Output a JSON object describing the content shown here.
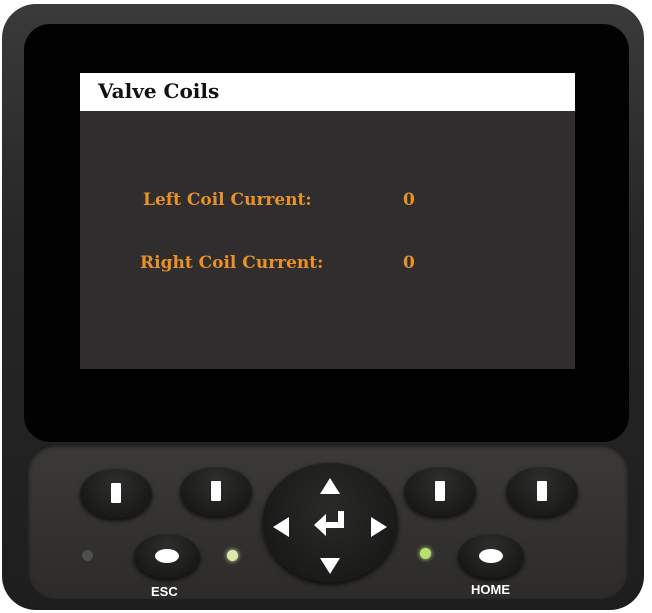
{
  "screen": {
    "title": "Valve Coils",
    "rows": [
      {
        "label": "Left Coil Current:",
        "value": "0"
      },
      {
        "label": "Right Coil Current:",
        "value": "0"
      }
    ]
  },
  "keypad": {
    "esc_label": "ESC",
    "home_label": "HOME",
    "led_colors": {
      "left": "#555555",
      "middle": "#d8e8a0",
      "right": "#b8e070"
    }
  },
  "colors": {
    "accent": "#e8902a",
    "screen_bg": "#2f2d2e",
    "title_bg": "#ffffff"
  }
}
